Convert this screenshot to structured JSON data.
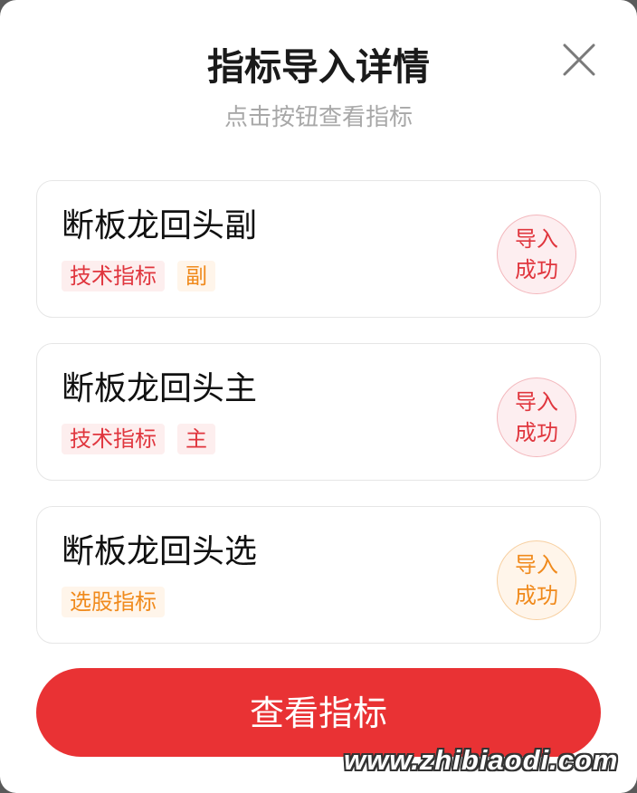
{
  "modal": {
    "title": "指标导入详情",
    "subtitle": "点击按钮查看指标",
    "close_icon": "close-icon"
  },
  "cards": [
    {
      "name": "断板龙回头副",
      "tags": [
        {
          "text": "技术指标",
          "color": "#e0363e"
        },
        {
          "text": "副",
          "color": "#f08a1c"
        }
      ],
      "stamp": {
        "line1": "导入",
        "line2": "成功",
        "color": "#e0363e"
      }
    },
    {
      "name": "断板龙回头主",
      "tags": [
        {
          "text": "技术指标",
          "color": "#e0363e"
        },
        {
          "text": "主",
          "color": "#e0363e"
        }
      ],
      "stamp": {
        "line1": "导入",
        "line2": "成功",
        "color": "#e0363e"
      }
    },
    {
      "name": "断板龙回头选",
      "tags": [
        {
          "text": "选股指标",
          "color": "#f08a1c"
        }
      ],
      "stamp": {
        "line1": "导入",
        "line2": "成功",
        "color": "#f08a1c"
      }
    }
  ],
  "button": {
    "label": "查看指标",
    "color": "#e93234"
  },
  "watermark": "www.zhibiaodi.com"
}
